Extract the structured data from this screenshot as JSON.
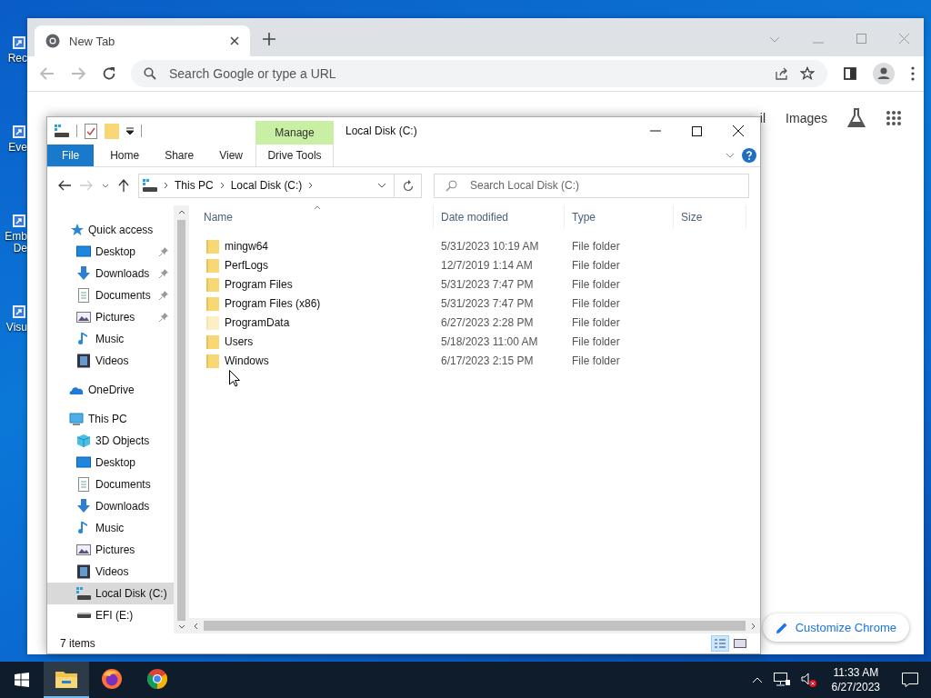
{
  "desktop_icons": [
    {
      "label": "Rec"
    },
    {
      "label": "Eve"
    },
    {
      "label": "Emb De"
    },
    {
      "label": "Visu"
    }
  ],
  "browser": {
    "tab": {
      "title": "New Tab"
    },
    "address_bar": {
      "placeholder": "Search Google or type a URL"
    },
    "header_links": [
      "il",
      "Images"
    ],
    "customize_button": "Customize Chrome"
  },
  "explorer": {
    "title": "Local Disk (C:)",
    "context_group": "Manage",
    "context_tab": "Drive Tools",
    "ribbon_tabs": [
      {
        "label": "File",
        "kind": "file"
      },
      {
        "label": "Home",
        "kind": "tab"
      },
      {
        "label": "Share",
        "kind": "tab"
      },
      {
        "label": "View",
        "kind": "tab"
      }
    ],
    "breadcrumb": [
      "This PC",
      "Local Disk (C:)"
    ],
    "search": {
      "placeholder": "Search Local Disk (C:)"
    },
    "nav": [
      {
        "label": "Quick access",
        "kind": "quick",
        "selected": false,
        "children": [
          {
            "label": "Desktop",
            "kind": "desktop",
            "pinned": true,
            "selected": false
          },
          {
            "label": "Downloads",
            "kind": "downloads",
            "pinned": true,
            "selected": false
          },
          {
            "label": "Documents",
            "kind": "documents",
            "pinned": true,
            "selected": false
          },
          {
            "label": "Pictures",
            "kind": "pictures",
            "pinned": true,
            "selected": false
          },
          {
            "label": "Music",
            "kind": "music",
            "pinned": false,
            "selected": false
          },
          {
            "label": "Videos",
            "kind": "videos",
            "pinned": false,
            "selected": false
          }
        ]
      },
      {
        "label": "OneDrive",
        "kind": "onedrive",
        "selected": false
      },
      {
        "label": "This PC",
        "kind": "pc",
        "selected": false,
        "children": [
          {
            "label": "3D Objects",
            "kind": "objects3d",
            "pinned": false,
            "selected": false
          },
          {
            "label": "Desktop",
            "kind": "desktop",
            "pinned": false,
            "selected": false
          },
          {
            "label": "Documents",
            "kind": "documents",
            "pinned": false,
            "selected": false
          },
          {
            "label": "Downloads",
            "kind": "downloads",
            "pinned": false,
            "selected": false
          },
          {
            "label": "Music",
            "kind": "music",
            "pinned": false,
            "selected": false
          },
          {
            "label": "Pictures",
            "kind": "pictures",
            "pinned": false,
            "selected": false
          },
          {
            "label": "Videos",
            "kind": "videos",
            "pinned": false,
            "selected": false
          },
          {
            "label": "Local Disk (C:)",
            "kind": "drive_c",
            "pinned": false,
            "selected": true
          },
          {
            "label": "EFI (E:)",
            "kind": "drive",
            "pinned": false,
            "selected": false
          }
        ]
      }
    ],
    "columns": [
      "Name",
      "Date modified",
      "Type",
      "Size"
    ],
    "rows": [
      {
        "name": "mingw64",
        "date": "5/31/2023 10:19 AM",
        "type": "File folder",
        "hidden": false
      },
      {
        "name": "PerfLogs",
        "date": "12/7/2019 1:14 AM",
        "type": "File folder",
        "hidden": false
      },
      {
        "name": "Program Files",
        "date": "5/31/2023 7:47 PM",
        "type": "File folder",
        "hidden": false
      },
      {
        "name": "Program Files (x86)",
        "date": "5/31/2023 7:47 PM",
        "type": "File folder",
        "hidden": false
      },
      {
        "name": "ProgramData",
        "date": "6/27/2023 2:28 PM",
        "type": "File folder",
        "hidden": true
      },
      {
        "name": "Users",
        "date": "5/18/2023 11:00 AM",
        "type": "File folder",
        "hidden": false
      },
      {
        "name": "Windows",
        "date": "6/17/2023 2:15 PM",
        "type": "File folder",
        "hidden": false
      }
    ],
    "status": "7 items"
  },
  "taskbar": {
    "apps": [
      {
        "kind": "explorer",
        "active": true
      },
      {
        "kind": "firefox",
        "active": false
      },
      {
        "kind": "chrome",
        "active": false
      }
    ],
    "time": "11:33 AM",
    "date": "6/27/2023"
  }
}
